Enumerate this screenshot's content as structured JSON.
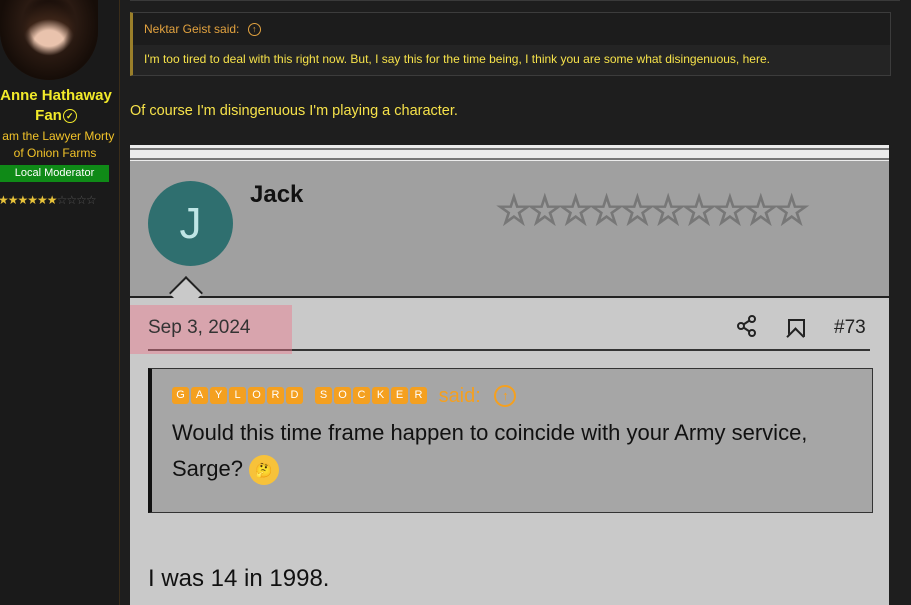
{
  "user": {
    "name": "Anne Hathaway Fan",
    "title": "I am the Lawyer Morty of Onion Farms",
    "badge": "Local Moderator",
    "rating_stars_full": "★★★★★",
    "rating_stars_half": "★",
    "rating_stars_empty": "☆☆☆☆",
    "verified_glyph": "✓"
  },
  "quote": {
    "author_said": "Nektar Geist said:",
    "arrow_glyph": "↑",
    "text": "I'm too tired to deal with this right now. But, I say this for the time being, I think you are some what disingenuous, here."
  },
  "reply": "Of course I'm disingenuous I'm playing a character.",
  "embed": {
    "avatar_letter": "J",
    "name": "Jack",
    "stars": "☆☆☆☆☆☆☆☆☆☆",
    "date": "Sep 3, 2024",
    "share_icon": "⋖",
    "post_number": "#73",
    "quote_author_letters_1": [
      "G",
      "A",
      "Y",
      "L",
      "O",
      "R",
      "D"
    ],
    "quote_author_letters_2": [
      "S",
      "O",
      "C",
      "K",
      "E",
      "R"
    ],
    "quote_said": "said:",
    "quote_arrow": "↑",
    "quote_text_1": "Would this time frame happen to coincide with your Army service,",
    "quote_text_2": "Sarge?",
    "emoji": "🤔",
    "reply": "I was 14 in 1998."
  },
  "colors": {
    "username": "#f2ea2a",
    "body_text": "#f6e24a",
    "quote_header": "#e2a23f",
    "badge_bg": "#0f8a17",
    "embed_accent": "#f4a020",
    "date_highlight": "#eb788c"
  }
}
